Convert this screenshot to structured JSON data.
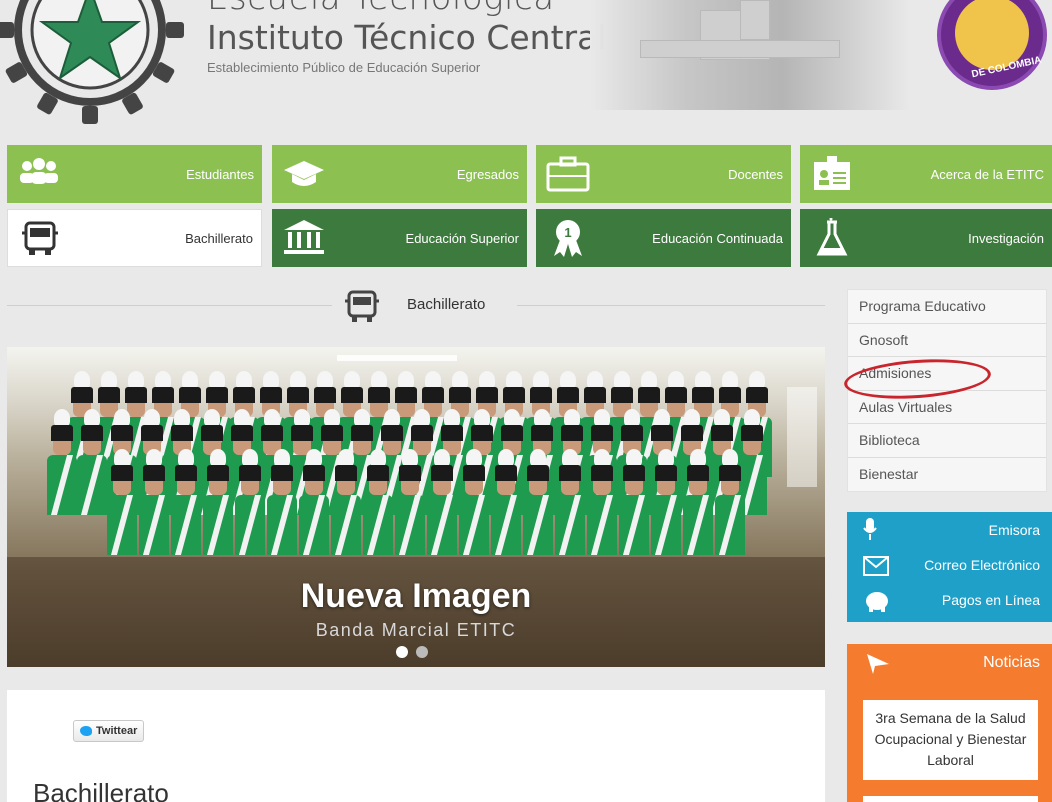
{
  "header": {
    "title_line1": "Escuela Tecnológica",
    "title_line2": "Instituto Técnico Central",
    "subtitle": "Establecimiento Público de Educación Superior",
    "seal_text": "DE COLOMBIA"
  },
  "nav": {
    "row1": [
      {
        "label": "Estudiantes",
        "icon": "students-icon"
      },
      {
        "label": "Egresados",
        "icon": "graduation-cap-icon"
      },
      {
        "label": "Docentes",
        "icon": "briefcase-icon"
      },
      {
        "label": "Acerca de la ETITC",
        "icon": "id-card-icon"
      }
    ],
    "row2": [
      {
        "label": "Bachillerato",
        "icon": "bus-icon"
      },
      {
        "label": "Educación Superior",
        "icon": "institution-icon"
      },
      {
        "label": "Educación Continuada",
        "icon": "award-icon"
      },
      {
        "label": "Investigación",
        "icon": "flask-icon"
      }
    ]
  },
  "section": {
    "title": "Bachillerato"
  },
  "slider": {
    "title": "Nueva Imagen",
    "subtitle": "Banda Marcial ETITC",
    "active_slide": 1,
    "slide_count": 2
  },
  "content": {
    "tweet_label": "Twittear",
    "title": "Bachillerato"
  },
  "sidebar": {
    "menu": [
      "Programa Educativo",
      "Gnosoft",
      "Admisiones",
      "Aulas Virtuales",
      "Biblioteca",
      "Bienestar"
    ],
    "highlighted": "Admisiones",
    "services": [
      {
        "label": "Emisora",
        "icon": "microphone-icon"
      },
      {
        "label": "Correo Electrónico",
        "icon": "envelope-icon"
      },
      {
        "label": "Pagos en Línea",
        "icon": "piggy-bank-icon"
      }
    ],
    "news": {
      "heading": "Noticias",
      "item1": "3ra Semana de la Salud Ocupacional y Bienestar Laboral"
    }
  },
  "colors": {
    "green_light": "#8cc152",
    "green_dark": "#3d7a3d",
    "blue": "#1ea0c8",
    "orange": "#f57c2f",
    "highlight_circle": "#c8252c"
  }
}
